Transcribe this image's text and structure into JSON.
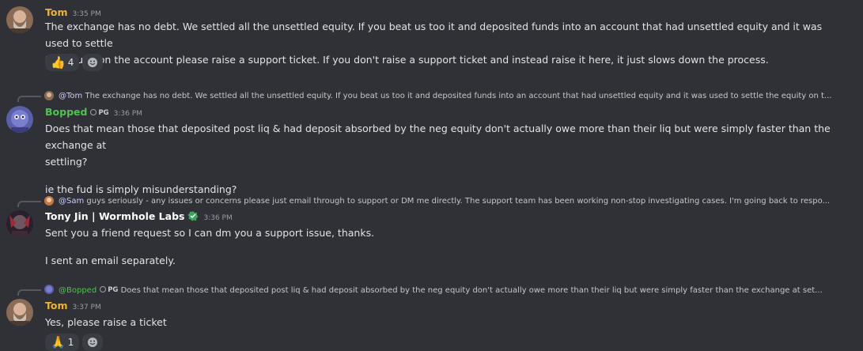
{
  "colors": {
    "background": "#2f3136",
    "tom_name": "#f0b232",
    "bopped_name": "#4fc34f",
    "tony_name": "#ffffff",
    "timestamp": "#9a9ca1",
    "mention": "#c9cdfb"
  },
  "messages": [
    {
      "author": "Tom",
      "time": "3:35 PM",
      "lines": [
        "The exchange has no debt. We settled all the unsettled equity. If you beat us too it and deposited funds into an account that had unsettled equity and it was used to settle",
        "the equity on the account please raise a support ticket. If you don't raise a support ticket and instead raise it here, it just slows down the process."
      ],
      "reactions": [
        {
          "icon": "thumbs-up-icon",
          "emoji": "👍",
          "count": "4"
        }
      ]
    },
    {
      "reply": {
        "mention": "@Tom",
        "text": "The exchange has no debt. We settled all the unsettled equity. If you beat us too it and deposited funds into an account that had unsettled equity and it was used to settle the equity on t..."
      },
      "author": "Bopped",
      "tag": "PG",
      "time": "3:36 PM",
      "lines": [
        "Does that mean those that deposited post liq & had deposit absorbed by the neg equity don't actually owe more than their liq but were simply faster than the exchange at",
        "settling?",
        "",
        "ie the fud is simply misunderstanding?"
      ]
    },
    {
      "reply": {
        "mention": "@Sam",
        "text": "guys seriously - any issues or concerns please just email through to support or DM me directly. The support team has been working non-stop investigating cases. I'm going back to respo..."
      },
      "author": "Tony Jin | Wormhole Labs",
      "time": "3:36 PM",
      "lines": [
        "Sent you a friend request so I can dm you a support issue, thanks.",
        "",
        "I sent an email separately."
      ]
    },
    {
      "reply": {
        "mention": "@Bopped",
        "tag": "PG",
        "text": "Does that mean those that deposited post liq & had deposit absorbed by the neg equity don't actually owe more than their liq but were simply faster than the exchange at set..."
      },
      "author": "Tom",
      "time": "3:37 PM",
      "lines": [
        "Yes, please raise a ticket"
      ],
      "reactions": [
        {
          "icon": "praying-hands-icon",
          "emoji": "🙏",
          "count": "1"
        }
      ]
    }
  ]
}
